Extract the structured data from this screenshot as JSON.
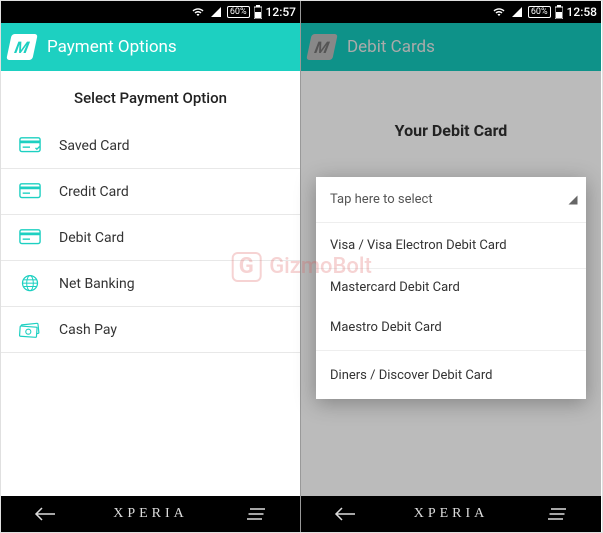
{
  "watermark": {
    "g": "G",
    "text": "GizmoBolt"
  },
  "screen1": {
    "status": {
      "battery": "60%",
      "time": "12:57"
    },
    "appbar": {
      "logo": "M",
      "title": "Payment Options"
    },
    "header": "Select Payment Option",
    "options": [
      {
        "label": "Saved Card"
      },
      {
        "label": "Credit Card"
      },
      {
        "label": "Debit Card"
      },
      {
        "label": "Net Banking"
      },
      {
        "label": "Cash Pay"
      }
    ],
    "nav": {
      "home": "XPERIA"
    }
  },
  "screen2": {
    "status": {
      "battery": "60%",
      "time": "12:58"
    },
    "appbar": {
      "logo": "M",
      "title": "Debit Cards"
    },
    "header": "Your Debit Card",
    "popup": {
      "header": "Tap here to select",
      "items": [
        "Visa / Visa Electron Debit Card",
        "Mastercard Debit Card",
        "Maestro Debit Card",
        "Diners / Discover Debit Card"
      ]
    },
    "nav": {
      "home": "XPERIA"
    }
  }
}
